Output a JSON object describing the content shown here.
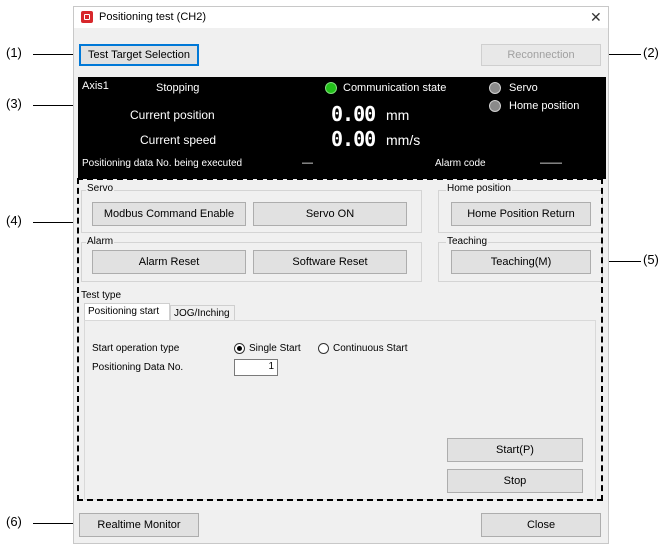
{
  "window": {
    "title": "Positioning test (CH2)",
    "close_icon": "close-icon",
    "app_icon": "app-icon"
  },
  "toolbar": {
    "test_target_selection": "Test Target Selection",
    "reconnection": "Reconnection"
  },
  "status": {
    "axis": "Axis1",
    "state": "Stopping",
    "communication_state": "Communication state",
    "servo": "Servo",
    "home_position": "Home position",
    "current_position_label": "Current position",
    "current_position_value": "0.00",
    "current_position_unit": "mm",
    "current_speed_label": "Current speed",
    "current_speed_value": "0.00",
    "current_speed_unit": "mm/s",
    "positioning_data_label": "Positioning data No. being executed",
    "positioning_data_value": "—",
    "alarm_code_label": "Alarm code",
    "alarm_code_value": "——",
    "colors": {
      "communication": "#22c11a",
      "inactive": "#8a8a8a"
    }
  },
  "servo_group": {
    "label": "Servo",
    "modbus_enable": "Modbus Command Enable",
    "servo_on": "Servo ON"
  },
  "home_group": {
    "label": "Home position",
    "home_return": "Home Position Return"
  },
  "alarm_group": {
    "label": "Alarm",
    "alarm_reset": "Alarm Reset",
    "software_reset": "Software Reset"
  },
  "teaching_group": {
    "label": "Teaching",
    "teaching": "Teaching(M)"
  },
  "test_type": {
    "label": "Test type",
    "tabs": [
      "Positioning start",
      "JOG/Inching"
    ],
    "start_operation_type_label": "Start operation type",
    "single_start": "Single Start",
    "continuous_start": "Continuous Start",
    "selected": "Single Start",
    "positioning_data_no_label": "Positioning Data No.",
    "positioning_data_no_value": "1",
    "start": "Start(P)",
    "stop": "Stop"
  },
  "footer": {
    "realtime_monitor": "Realtime Monitor",
    "close": "Close"
  },
  "callouts": [
    "(1)",
    "(2)",
    "(3)",
    "(4)",
    "(5)",
    "(6)"
  ]
}
